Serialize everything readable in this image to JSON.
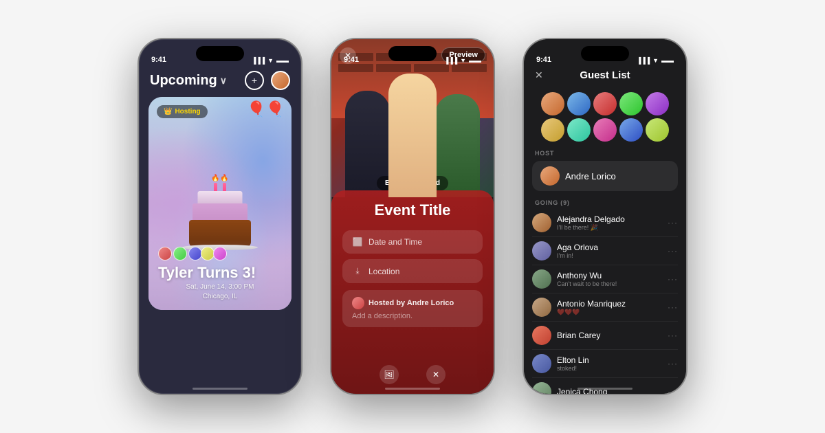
{
  "phones": {
    "phone1": {
      "status_time": "9:41",
      "title": "Upcoming",
      "hosting_badge": "Hosting",
      "add_icon": "+",
      "event": {
        "title": "Tyler Turns 3!",
        "date": "Sat, June 14, 3:00 PM",
        "location": "Chicago, IL",
        "candle_emoji": "🎂"
      }
    },
    "phone2": {
      "status_time": "9:41",
      "preview_label": "Preview",
      "close_icon": "✕",
      "edit_background": "Edit Background",
      "event_title": "Event Title",
      "date_time_field": "Date and Time",
      "location_field": "Location",
      "hosted_by": "Hosted by Andre Lorico",
      "add_description": "Add a description."
    },
    "phone3": {
      "status_time": "9:41",
      "close_icon": "✕",
      "title": "Guest List",
      "host_section": "HOST",
      "going_section": "GOING (9)",
      "host_name": "Andre Lorico",
      "guests": [
        {
          "name": "Alejandra Delgado",
          "status": "I'll be there! 🎉",
          "avatar_class": "gra1"
        },
        {
          "name": "Aga Orlova",
          "status": "I'm in!",
          "avatar_class": "gra2"
        },
        {
          "name": "Anthony Wu",
          "status": "Can't wait to be there!",
          "avatar_class": "gra3"
        },
        {
          "name": "Antonio Manriquez",
          "status": "❤️❤️❤️",
          "avatar_class": "gra4"
        },
        {
          "name": "Brian Carey",
          "status": "",
          "avatar_class": "gra5"
        },
        {
          "name": "Elton Lin",
          "status": "stoked!",
          "avatar_class": "gra6"
        },
        {
          "name": "Jenica Chong",
          "status": "",
          "avatar_class": "gra7"
        }
      ]
    }
  }
}
